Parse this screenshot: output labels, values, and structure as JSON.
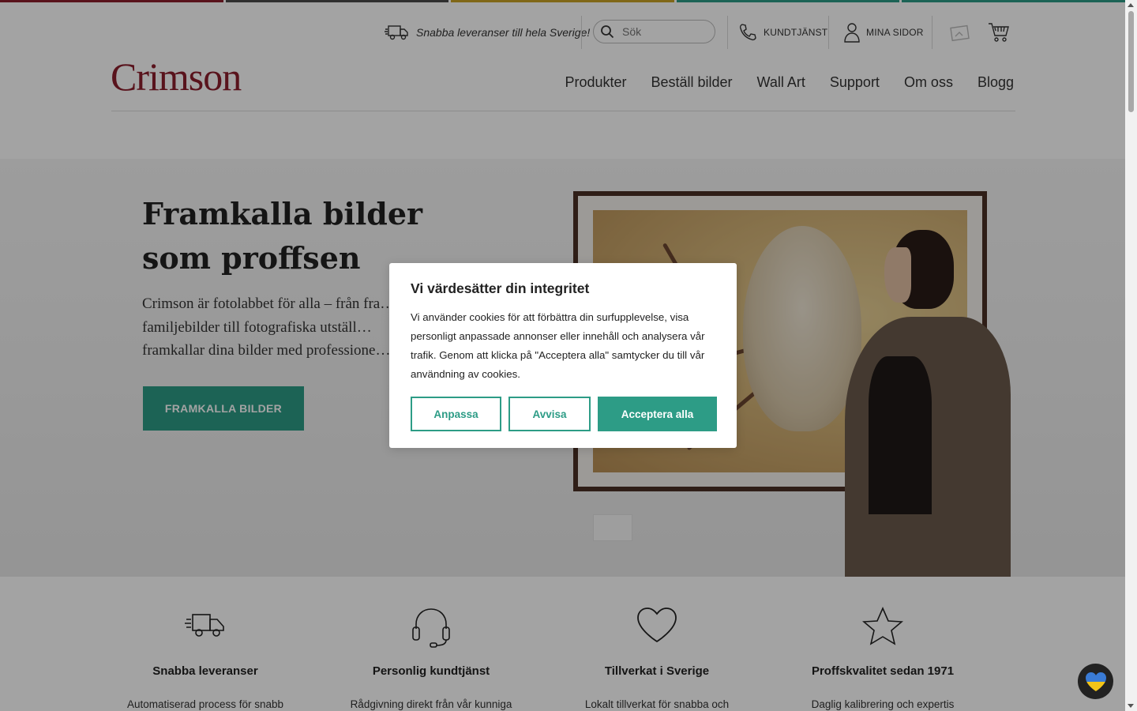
{
  "stripe": {
    "colors": [
      "#8b1e2d",
      "#4a4a4a",
      "#c9a227",
      "#2d9c86",
      "#2d9c86"
    ]
  },
  "utility": {
    "delivery_text": "Snabba leveranser till hela Sverige!",
    "search_placeholder": "Sök",
    "customer_service_label": "KUNDTJÄNST",
    "my_pages_label": "MINA SIDOR"
  },
  "header": {
    "logo_text": "Crimson",
    "nav": [
      "Produkter",
      "Beställ bilder",
      "Wall Art",
      "Support",
      "Om oss",
      "Blogg"
    ]
  },
  "hero": {
    "title": "Framkalla bilder som proffsen",
    "text": "Crimson är fotolabbet för alla – från fra… av familjebilder till fotografiska utställ… framkallar dina bilder med professione…",
    "cta_label": "FRAMKALLA BILDER"
  },
  "cookie_modal": {
    "title": "Vi värdesätter din integritet",
    "body": "Vi använder cookies för att förbättra din surfupplevelse, visa personligt anpassade annonser eller innehåll och analysera vår trafik. Genom att klicka på \"Acceptera alla\" samtycker du till vår användning av cookies.",
    "customize_label": "Anpassa",
    "reject_label": "Avvisa",
    "accept_label": "Acceptera alla"
  },
  "features": [
    {
      "icon": "truck-icon",
      "title": "Snabba leveranser",
      "text": "Automatiserad process för snabb"
    },
    {
      "icon": "headset-icon",
      "title": "Personlig kundtjänst",
      "text": "Rådgivning direkt från vår kunniga"
    },
    {
      "icon": "heart-icon",
      "title": "Tillverkat i Sverige",
      "text": "Lokalt tillverkat för snabba och"
    },
    {
      "icon": "star-icon",
      "title": "Proffskvalitet sedan 1971",
      "text": "Daglig kalibrering och expertis"
    }
  ],
  "colors": {
    "brand": "#8b1e2d",
    "accent": "#2d9c86"
  }
}
